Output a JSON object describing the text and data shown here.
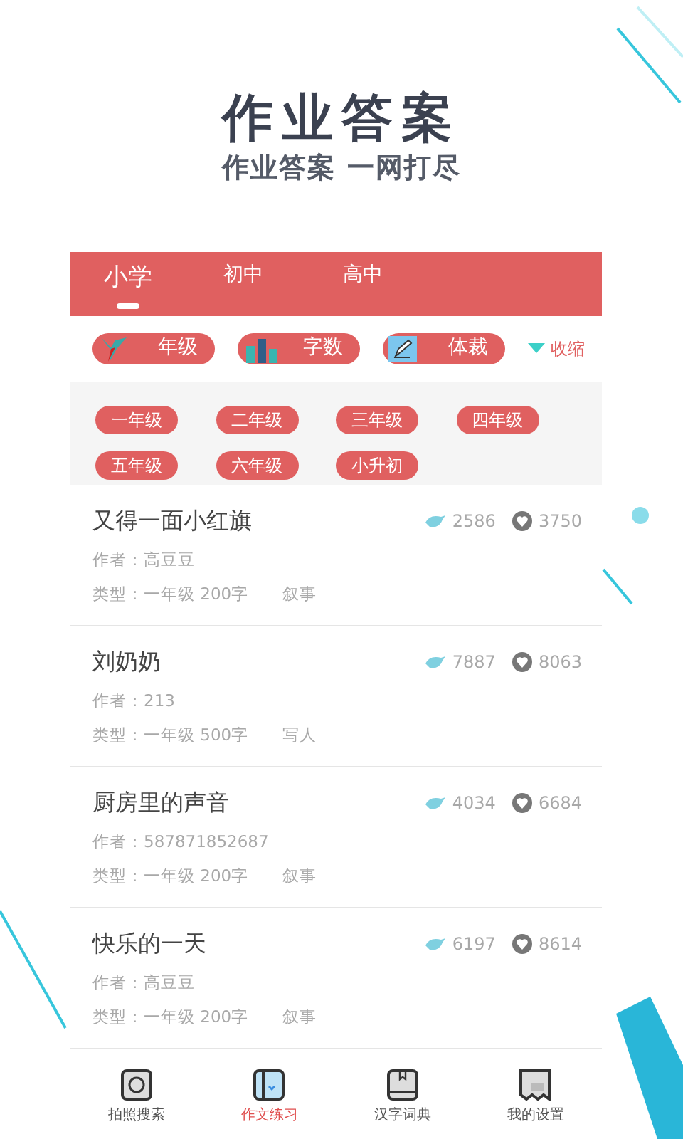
{
  "headline": "作业答案",
  "tagline": "作业答案 一网打尽",
  "tabs": [
    {
      "label": "小学",
      "selected": true
    },
    {
      "label": "初中",
      "selected": false
    },
    {
      "label": "高中",
      "selected": false
    }
  ],
  "filters": [
    {
      "label": "年级",
      "kind": "bird"
    },
    {
      "label": "字数",
      "kind": "bars"
    },
    {
      "label": "体裁",
      "kind": "pen"
    }
  ],
  "collapse_toggle": {
    "label": "收缩",
    "expanded": true
  },
  "grades": [
    "一年级",
    "二年级",
    "三年级",
    "四年级",
    "五年级",
    "六年级",
    "小升初"
  ],
  "essays": [
    {
      "title": "又得一面小红旗",
      "author": "作者：高豆豆",
      "type": "类型：一年级 200字",
      "genre": "叙事",
      "views": "2586",
      "likes": "3750"
    },
    {
      "title": "刘奶奶",
      "author": "作者：213",
      "type": "类型：一年级 500字",
      "genre": "写人",
      "views": "7887",
      "likes": "8063"
    },
    {
      "title": "厨房里的声音",
      "author": "作者：587871852687",
      "type": "类型：一年级 200字",
      "genre": "叙事",
      "views": "4034",
      "likes": "6684"
    },
    {
      "title": "快乐的一天",
      "author": "作者：高豆豆",
      "type": "类型：一年级 200字",
      "genre": "叙事",
      "views": "6197",
      "likes": "8614"
    }
  ],
  "bottom_nav": [
    {
      "label": "拍照搜索",
      "kind": "camera",
      "selected": false
    },
    {
      "label": "作文练习",
      "kind": "notebook",
      "selected": true
    },
    {
      "label": "汉字词典",
      "kind": "book",
      "selected": false
    },
    {
      "label": "我的设置",
      "kind": "dictionary",
      "selected": false
    }
  ]
}
